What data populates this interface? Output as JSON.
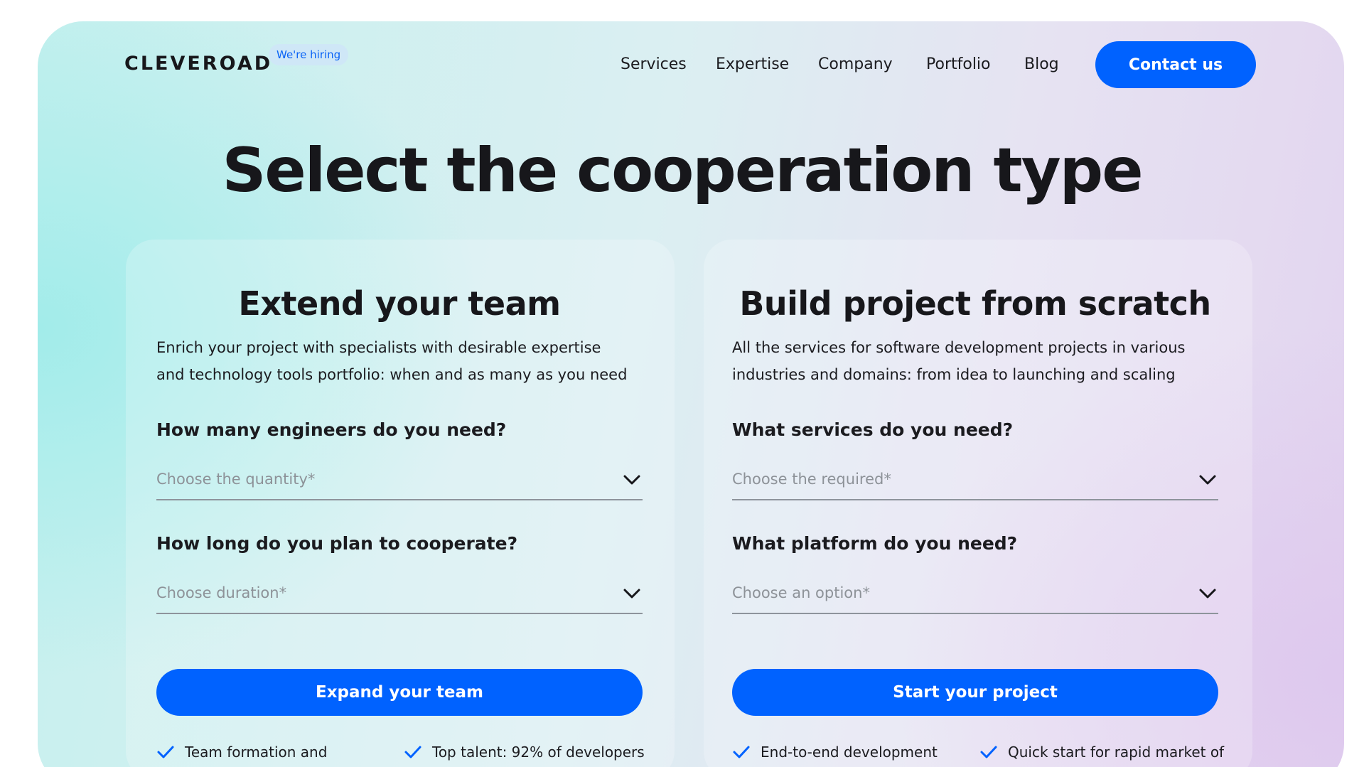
{
  "header": {
    "logo": "CLEVEROAD",
    "hiring_badge": "We're hiring",
    "nav": [
      "Services",
      "Expertise",
      "Company",
      "Portfolio",
      "Blog"
    ],
    "contact_label": "Contact us"
  },
  "page_title": "Select the cooperation type",
  "left_card": {
    "title": "Extend your team",
    "description_line1": "Enrich your project with specialists with desirable expertise",
    "description_line2": "and technology tools portfolio: when and as many as you need",
    "q1": "How many engineers do you need?",
    "q1_placeholder": "Choose the quantity*",
    "q2": "How long do you plan to cooperate?",
    "q2_placeholder": "Choose duration*",
    "cta": "Expand your team",
    "features": [
      "Team formation and",
      "Top talent: 92% of developers"
    ]
  },
  "right_card": {
    "title": "Build project from scratch",
    "description_line1": "All the services for software development projects in various",
    "description_line2": "industries and domains: from idea to launching and scaling",
    "q1": "What services do you need?",
    "q1_placeholder": "Choose the required*",
    "q2": "What platform do you need?",
    "q2_placeholder": "Choose an option*",
    "cta": "Start your project",
    "features": [
      "End-to-end development",
      "Quick start for rapid market of"
    ]
  },
  "icons": {
    "select": "chevron-down-icon",
    "feature": "check-icon"
  },
  "colors": {
    "accent": "#0062ff",
    "badge_bg": "#cfe7f7",
    "text": "#1b1b1f",
    "placeholder": "#8d9298"
  }
}
